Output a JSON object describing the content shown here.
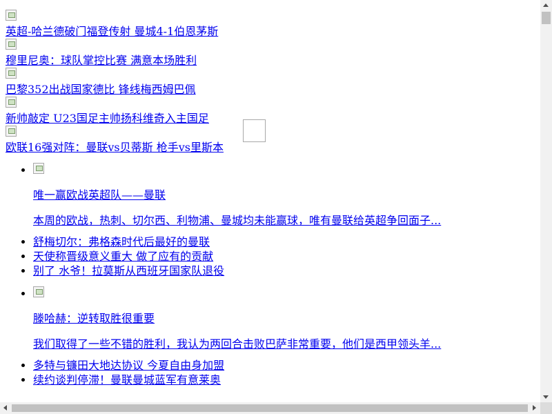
{
  "slider": {
    "items": [
      {
        "title": "英超-哈兰德破门福登传射 曼城4-1伯恩茅斯"
      },
      {
        "title": "穆里尼奥：球队掌控比赛 满意本场胜利"
      },
      {
        "title": "巴黎352出战国家德比 锋线梅西姆巴佩"
      },
      {
        "title": "新帅敲定 U23国足主帅扬科维奇入主国足"
      },
      {
        "title": "欧联16强对阵：曼联vs贝蒂斯 枪手vs里斯本"
      }
    ]
  },
  "news": {
    "group1": {
      "feature": {
        "title": "唯一赢欧战英超队——曼联",
        "summary": "本周的欧战，热刺、切尔西、利物浦、曼城均未能赢球，唯有曼联给英超争回面子..."
      },
      "links": [
        {
          "title": "舒梅切尔：弗格森时代后最好的曼联"
        },
        {
          "title": "天使称晋级意义重大 做了应有的贡献"
        },
        {
          "title": "别了 水爷！拉莫斯从西班牙国家队退役"
        }
      ]
    },
    "group2": {
      "feature": {
        "title": "滕哈赫：逆转取胜很重要",
        "summary": "我们取得了一些不错的胜利，我认为两回合击败巴萨非常重要，他们是西甲领头羊..."
      },
      "links": [
        {
          "title": "多特与镰田大地达协议 今夏自由身加盟"
        },
        {
          "title": "续约谈判停滞！曼联曼城蓝军有意莱奥"
        }
      ]
    }
  }
}
